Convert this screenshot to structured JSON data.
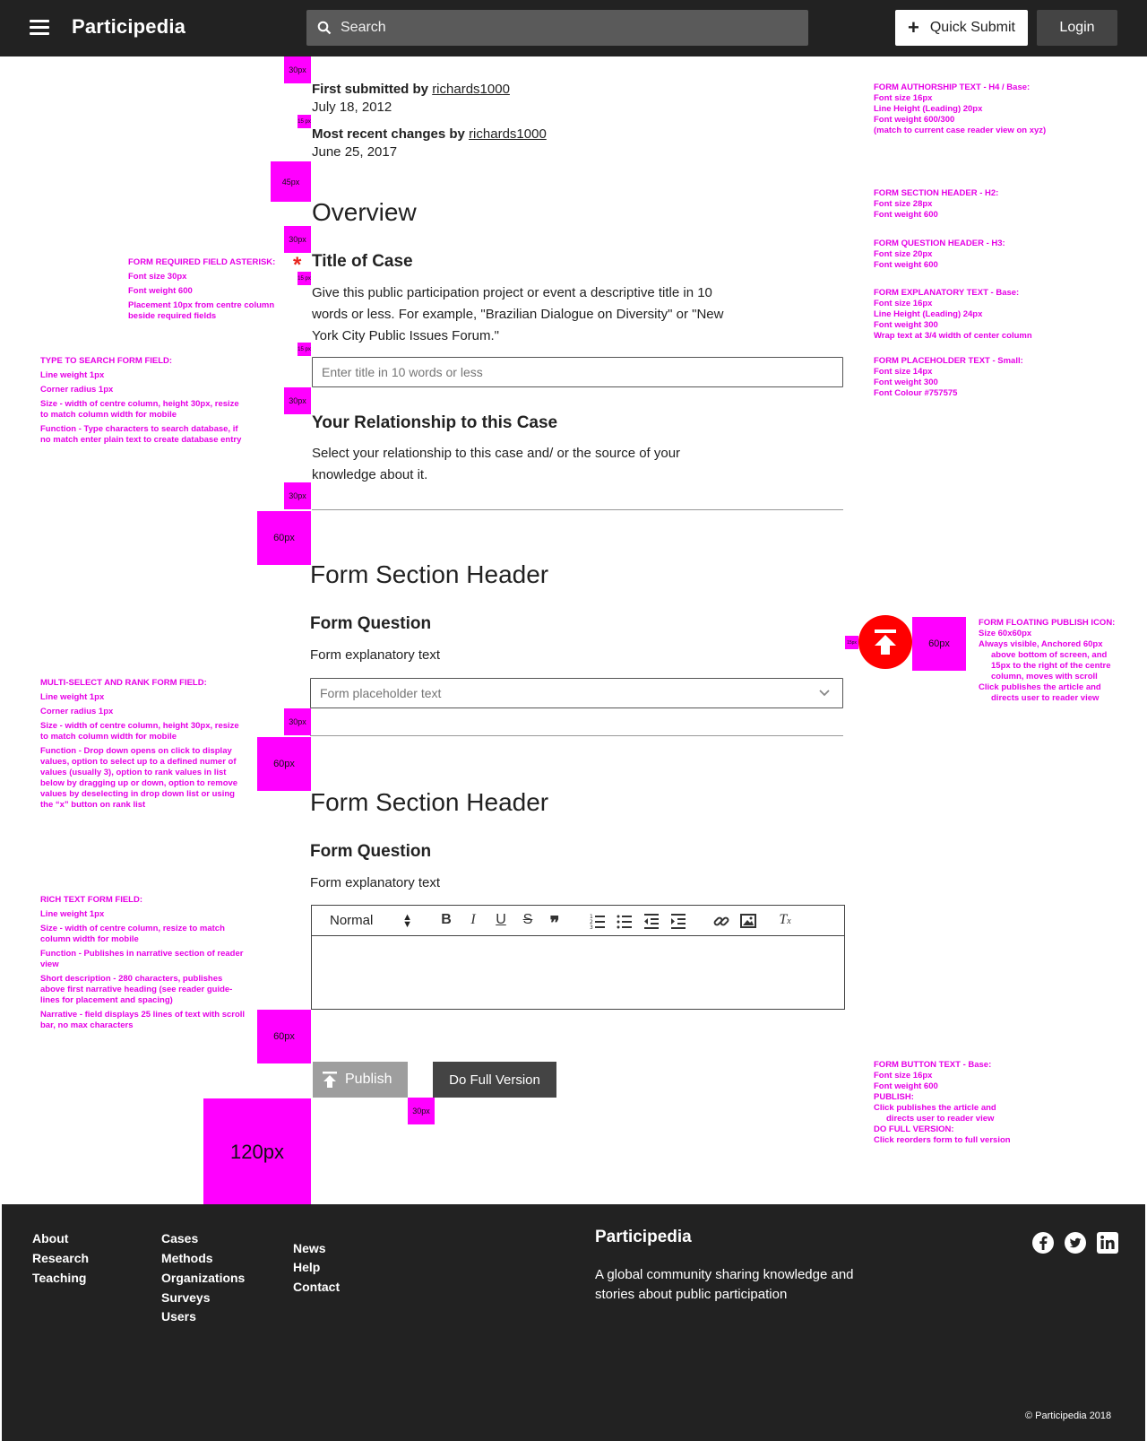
{
  "header": {
    "brand": "Participedia",
    "search_placeholder": "Search",
    "quick_submit": "Quick Submit",
    "login": "Login"
  },
  "meta": {
    "first_label": "First submitted by",
    "first_user": "richards1000",
    "first_date": "July 18, 2012",
    "recent_label": "Most recent changes by",
    "recent_user": "richards1000",
    "recent_date": "June 25, 2017"
  },
  "overview": {
    "heading": "Overview",
    "title_q": "Title of Case",
    "asterisk": "*",
    "title_expl_1": "Give this public participation project or event a descriptive title in 10",
    "title_expl_2": "words or less. For example, \"Brazilian Dialogue on Diversity\" or \"New",
    "title_expl_3": "York City Public Issues Forum.\"",
    "title_placeholder": "Enter title in 10 words or less",
    "rel_q": "Your Relationship to this Case",
    "rel_expl_1": "Select your relationship to this case and/ or the source of your",
    "rel_expl_2": "knowledge about it."
  },
  "section1": {
    "heading": "Form Section Header",
    "question": "Form Question",
    "expl": "Form explanatory text",
    "placeholder": "Form placeholder text"
  },
  "section2": {
    "heading": "Form Section Header",
    "question": "Form Question",
    "expl": "Form explanatory text",
    "toolbar_format": "Normal"
  },
  "buttons": {
    "publish": "Publish",
    "full_version": "Do Full Version"
  },
  "spacing_markers": {
    "s30": "30px",
    "s15": "15 px",
    "s45": "45px",
    "s60": "60px",
    "s120": "120px",
    "s15b": "15px"
  },
  "annotations": {
    "authorship": [
      "FORM AUTHORSHIP TEXT - H4 / Base:",
      "Font size 16px",
      "Line Height (Leading) 20px",
      "Font weight 600/300",
      "(match to current case reader view on xyz)"
    ],
    "section_header": [
      "FORM SECTION HEADER - H2:",
      "Font size 28px",
      "Font weight 600"
    ],
    "question_header": [
      "FORM QUESTION HEADER - H3:",
      "Font size 20px",
      "Font weight 600"
    ],
    "explanatory": [
      "FORM EXPLANATORY TEXT - Base:",
      "Font size 16px",
      "Line Height (Leading) 24px",
      "Font weight  300",
      "Wrap text at 3/4 width of center column"
    ],
    "placeholder": [
      "FORM PLACEHOLDER TEXT - Small:",
      "Font size 14px",
      "Font weight  300",
      "Font Colour #757575"
    ],
    "asterisk": [
      "FORM REQUIRED FIELD ASTERISK:",
      "Font size 30px",
      "Font weight 600",
      "Placement 10px from centre column",
      "beside required fields"
    ],
    "type_search": [
      "TYPE TO SEARCH FORM FIELD:",
      "Line weight 1px",
      "Corner radius 1px",
      "Size - width of centre column, height 30px, resize",
      "to match column width for mobile",
      "Function - Type characters to search database, if",
      "no match enter plain text to create database entry"
    ],
    "multi_select": [
      "MULTI-SELECT AND RANK FORM FIELD:",
      "Line weight 1px",
      "Corner radius 1px",
      "Size - width of centre column, height 30px, resize",
      "to match column width for mobile",
      "Function - Drop down opens on click to display",
      "values, option to select up to a defined numer of",
      "values (usually 3), option to rank values in list",
      "below by dragging up or down, option to remove",
      "values by deselecting in drop down list or using",
      "the “x” button on rank list"
    ],
    "rich_text": [
      "RICH TEXT FORM FIELD:",
      "Line weight 1px",
      "Size - width of centre column, resize to match",
      "column width for mobile",
      "Function - Publishes in narrative section of reader",
      "view",
      "Short description - 280 characters, publishes",
      "above first narrative heading (see reader guide-",
      "lines for placement and spacing)",
      "Narrative - field displays 25 lines of text with scroll",
      "bar, no max characters"
    ],
    "floating": [
      "FORM FLOATING PUBLISH ICON:",
      "Size 60x60px",
      "Always visible, Anchored 60px",
      "above bottom of screen, and",
      "15px to the right of the centre",
      "column, moves with scroll",
      "Click publishes the article and",
      "directs user to reader view"
    ],
    "button_text": [
      "FORM BUTTON TEXT - Base:",
      "Font size 16px",
      "Font weight 600",
      "PUBLISH:",
      "Click publishes the article and",
      "directs user to reader view",
      "DO FULL VERSION:",
      "Click reorders form to full version"
    ]
  },
  "footer": {
    "col1": [
      "About",
      "Research",
      "Teaching"
    ],
    "col2": [
      "Cases",
      "Methods",
      "Organizations",
      "Surveys",
      "Users"
    ],
    "col3": [
      "News",
      "Help",
      "Contact"
    ],
    "brand": "Participedia",
    "tagline": "A global community sharing knowledge and stories about public participation",
    "copyright": "© Participedia 2018",
    "social_icons": [
      "facebook-icon",
      "twitter-icon",
      "linkedin-icon"
    ]
  },
  "colors": {
    "header_bg": "#222222",
    "accent_magenta": "#ff00ff",
    "publish_red": "#ff0000",
    "asterisk_red": "#e8261f",
    "placeholder": "#757575"
  }
}
